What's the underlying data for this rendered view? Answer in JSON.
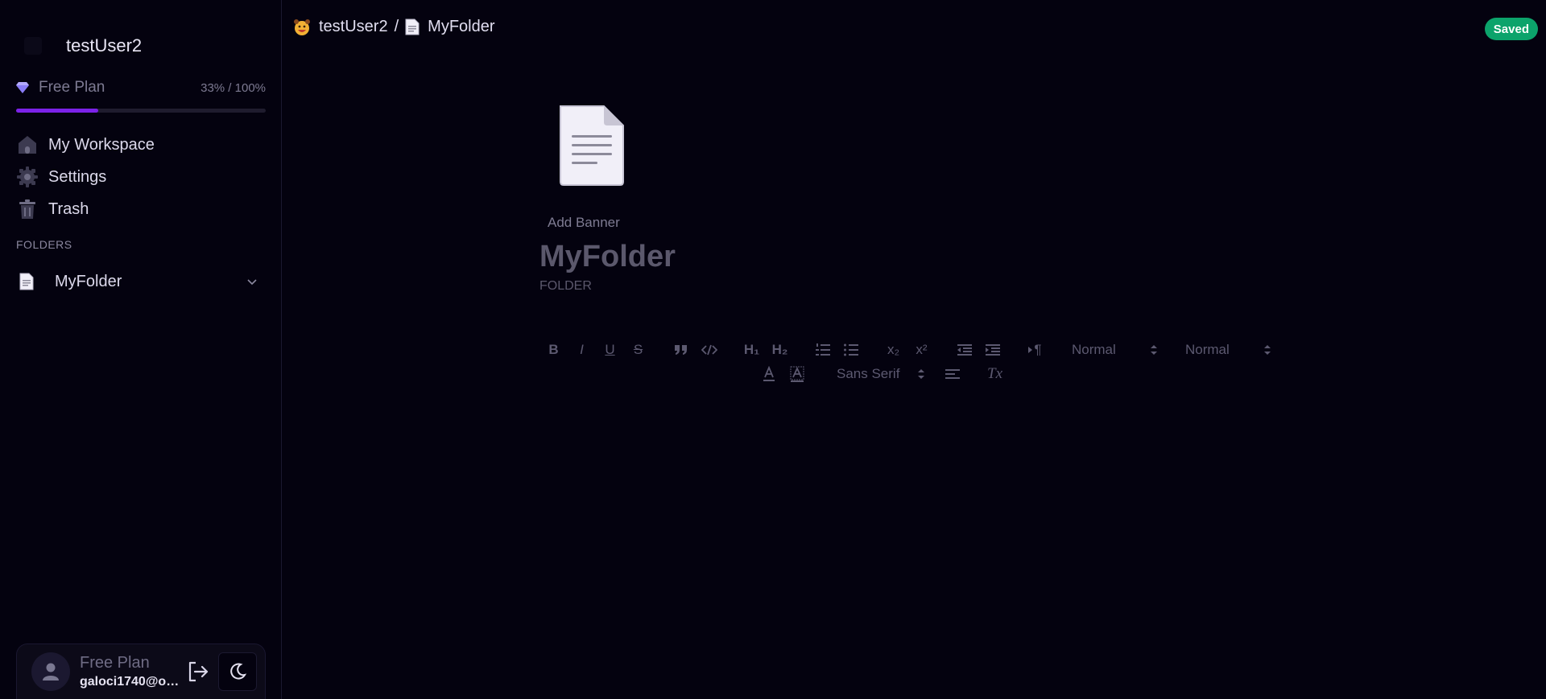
{
  "workspace": {
    "name": "testUser2"
  },
  "plan": {
    "label": "Free Plan",
    "usage_text": "33% / 100%",
    "usage_fraction": 0.33,
    "bar_color": "#7c22e8"
  },
  "nav": {
    "items": [
      {
        "label": "My Workspace",
        "icon": "home-icon"
      },
      {
        "label": "Settings",
        "icon": "gear-icon"
      },
      {
        "label": "Trash",
        "icon": "trash-icon"
      }
    ]
  },
  "folders": {
    "heading": "FOLDERS",
    "items": [
      {
        "name": "MyFolder",
        "icon": "document-emoji-icon"
      }
    ]
  },
  "user": {
    "plan": "Free Plan",
    "email": "galoci1740@oci..."
  },
  "breadcrumb": {
    "workspace": "testUser2",
    "separator": "/",
    "folder": "MyFolder"
  },
  "status": {
    "label": "Saved",
    "color": "#0ca36b"
  },
  "document": {
    "add_banner": "Add Banner",
    "title": "MyFolder",
    "type": "FOLDER"
  },
  "toolbar": {
    "bold": "B",
    "italic": "I",
    "underline": "U",
    "strike": "S",
    "h1": "H₁",
    "h2": "H₂",
    "subscript": "x₂",
    "superscript": "x²",
    "direction": "¶",
    "size_select": "Normal",
    "header_select": "Normal",
    "font_select": "Sans Serif",
    "clean": "Tx"
  }
}
